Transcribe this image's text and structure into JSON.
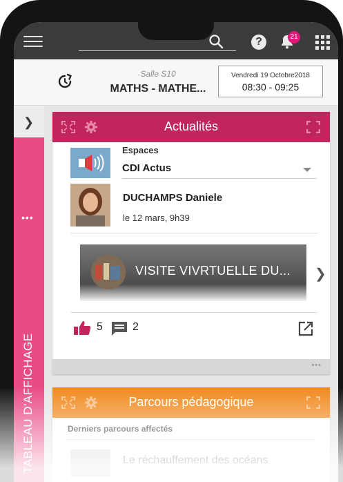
{
  "appbar": {
    "notification_count": "21"
  },
  "classbar": {
    "room": "Salle S10",
    "course": "MATHS - MATHE...",
    "date": "Vendredi 19 Octobre2018",
    "time": "08:30 - 09:25"
  },
  "rail": {
    "dots": "•••",
    "label": "TABLEAU D'AFFICHAGE"
  },
  "actualites": {
    "title": "Actualités",
    "spaces_label": "Espaces",
    "spaces_value": "CDI Actus",
    "author": "DUCHAMPS Daniele",
    "post_date": "le 12 mars, 9h39",
    "banner_text": "VISITE VIVRTUELLE DU...",
    "likes": "5",
    "comments": "2",
    "more": "•••"
  },
  "parcours": {
    "title": "Parcours pédagogique",
    "subtitle": "Derniers parcours affectés",
    "item_title": "Le réchauffement des océans"
  },
  "colors": {
    "rail": "#e94b87",
    "actualites_header": "#c1255e",
    "parcours_header": "#f08a1e",
    "appbar": "#3b3b3b",
    "like": "#c1255e"
  },
  "icons": [
    "menu-icon",
    "search-icon",
    "help-icon",
    "bell-icon",
    "apps-grid-icon",
    "refresh-icon",
    "chevron-right-icon",
    "expand-icon",
    "gear-icon",
    "fullscreen-icon",
    "megaphone-icon",
    "thumbs-up-icon",
    "comment-icon",
    "external-link-icon"
  ]
}
